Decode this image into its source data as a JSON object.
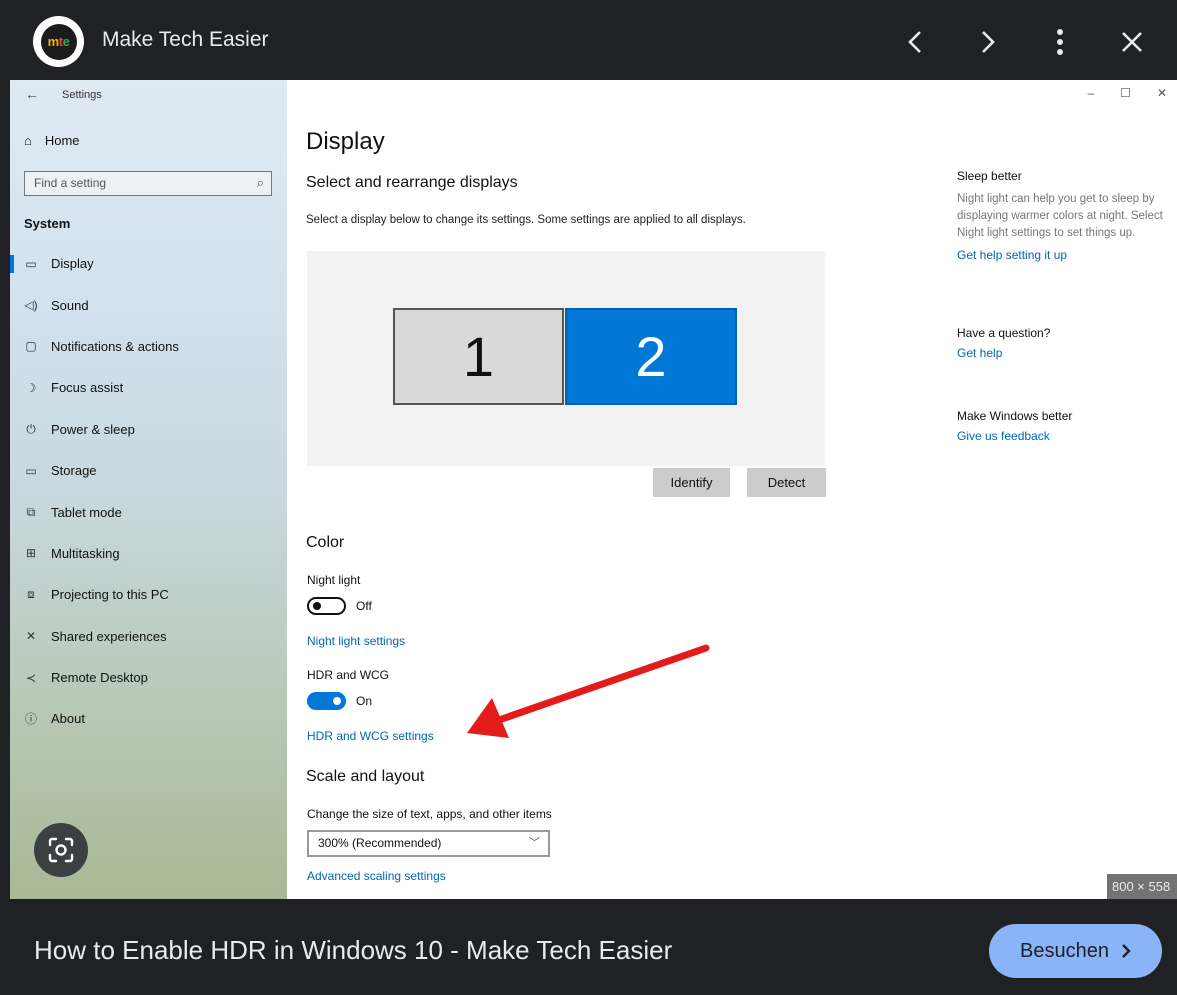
{
  "topbar": {
    "site_logo_text": [
      "m",
      "t",
      "e"
    ],
    "site_name": "Make Tech Easier"
  },
  "screenshot": {
    "window_title": "Settings",
    "sidebar": {
      "home": "Home",
      "search_placeholder": "Find a setting",
      "section": "System",
      "items": [
        {
          "label": "Display",
          "icon": "monitor-icon",
          "active": true
        },
        {
          "label": "Sound",
          "icon": "speaker-icon"
        },
        {
          "label": "Notifications & actions",
          "icon": "notification-icon"
        },
        {
          "label": "Focus assist",
          "icon": "moon-icon"
        },
        {
          "label": "Power & sleep",
          "icon": "power-icon"
        },
        {
          "label": "Storage",
          "icon": "storage-icon"
        },
        {
          "label": "Tablet mode",
          "icon": "tablet-icon"
        },
        {
          "label": "Multitasking",
          "icon": "multitasking-icon"
        },
        {
          "label": "Projecting to this PC",
          "icon": "projecting-icon"
        },
        {
          "label": "Shared experiences",
          "icon": "shared-icon"
        },
        {
          "label": "Remote Desktop",
          "icon": "remote-desktop-icon"
        },
        {
          "label": "About",
          "icon": "info-icon"
        }
      ]
    },
    "main": {
      "title": "Display",
      "subtitle": "Select and rearrange displays",
      "description": "Select a display below to change its settings. Some settings are applied to all displays.",
      "monitors": [
        "1",
        "2"
      ],
      "identify_button": "Identify",
      "detect_button": "Detect",
      "color_heading": "Color",
      "night_light_label": "Night light",
      "night_light_state": "Off",
      "night_light_link": "Night light settings",
      "hdr_label": "HDR and WCG",
      "hdr_state": "On",
      "hdr_link": "HDR and WCG settings",
      "scale_heading": "Scale and layout",
      "scale_desc": "Change the size of text, apps, and other items",
      "scale_value": "300% (Recommended)",
      "advanced_link": "Advanced scaling settings"
    },
    "right": {
      "sleep_heading": "Sleep better",
      "sleep_text": "Night light can help you get to sleep by displaying warmer colors at night. Select Night light settings to set things up.",
      "sleep_link": "Get help setting it up",
      "question_heading": "Have a question?",
      "question_link": "Get help",
      "better_heading": "Make Windows better",
      "better_link": "Give us feedback"
    },
    "dimensions": "800 × 558"
  },
  "caption": "How to Enable HDR in Windows 10 - Make Tech Easier",
  "visit_button": "Besuchen",
  "colors": {
    "accent": "#8ab4f8",
    "windows_blue": "#0078d7",
    "arrow_red": "#e31b1b"
  }
}
